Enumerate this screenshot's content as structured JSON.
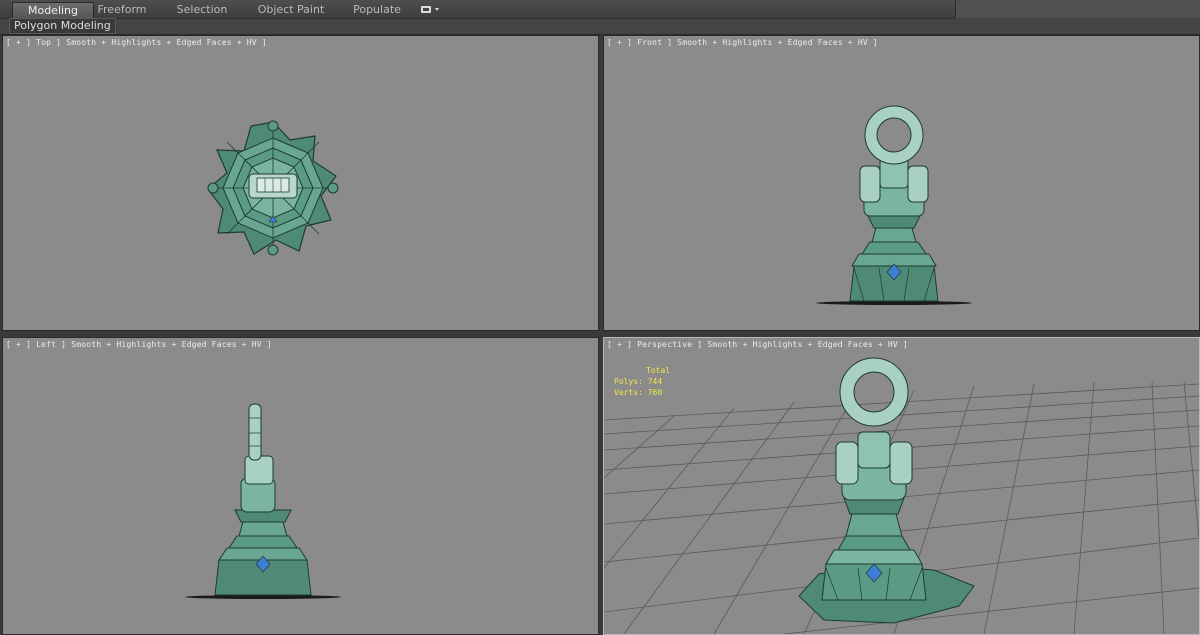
{
  "ribbon": {
    "tabs": [
      {
        "label": "Modeling",
        "active": true
      },
      {
        "label": "Freeform",
        "active": false
      },
      {
        "label": "Selection",
        "active": false
      },
      {
        "label": "Object Paint",
        "active": false
      },
      {
        "label": "Populate",
        "active": false
      }
    ],
    "panel_label": "Polygon Modeling"
  },
  "viewports": {
    "top": {
      "label": "[ + ] Top ] Smooth + Highlights + Edged Faces + HV ]"
    },
    "front": {
      "label": "[ + ] Front ] Smooth + Highlights + Edged Faces + HV ]"
    },
    "left": {
      "label": "[ + ] Left ] Smooth + Highlights + Edged Faces + HV ]"
    },
    "perspective": {
      "label": "[ + ] Perspective ] Smooth + Highlights + Edged Faces + HV ]"
    }
  },
  "stats": {
    "total_label": "Total",
    "polys_label": "Polys:",
    "polys_value": "744",
    "verts_label": "Verts:",
    "verts_value": "760"
  },
  "colors": {
    "viewport_bg": "#8b8b8b",
    "model_fill": "#5e9a86",
    "model_light": "#a9d1c2",
    "model_dark": "#2f5b4e",
    "gem": "#3d7fd6",
    "stats_text": "#f2e64a"
  }
}
